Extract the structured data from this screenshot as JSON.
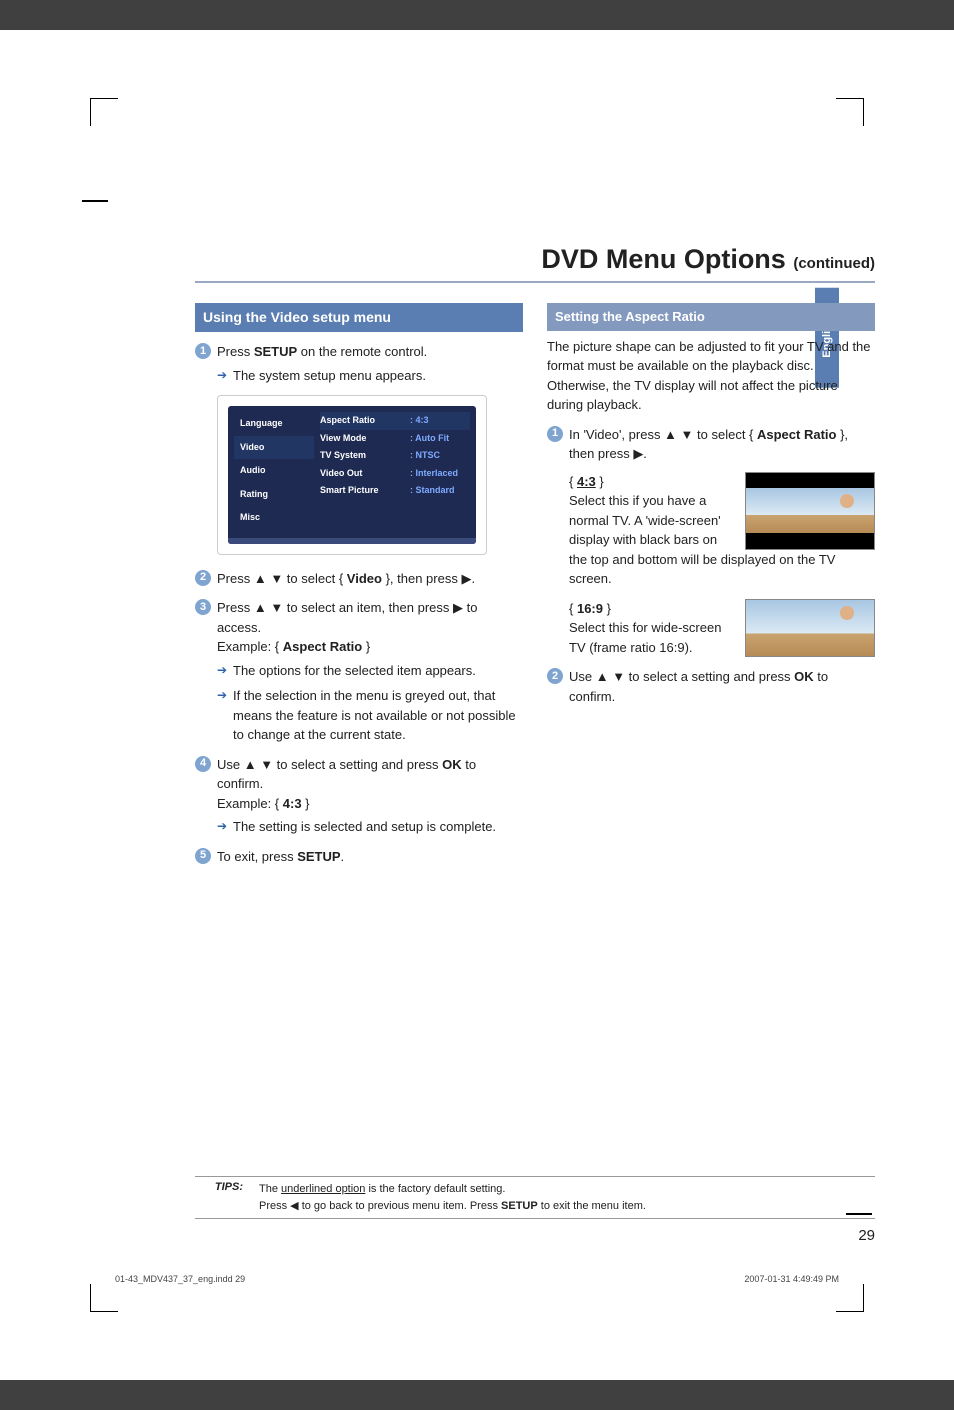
{
  "lang_tab": "English",
  "title": "DVD Menu Options",
  "title_sub": "(continued)",
  "left": {
    "heading": "Using the Video setup menu",
    "s1_a": "Press ",
    "s1_b": "SETUP",
    "s1_c": " on the remote control.",
    "s1_sub": "The system setup menu appears.",
    "s2_a": "Press ▲ ▼ to select { ",
    "s2_b": "Video",
    "s2_c": " }, then press ▶.",
    "s3": "Press ▲ ▼ to select an item, then press ▶ to access.",
    "s3_ex_a": "Example: { ",
    "s3_ex_b": "Aspect Ratio",
    "s3_ex_c": " }",
    "s3_sub1": "The options for the selected item appears.",
    "s3_sub2": "If the selection in the menu is greyed out, that means the feature is not available or not possible to change at the current state.",
    "s4_a": "Use ▲ ▼ to select a setting and press ",
    "s4_b": "OK",
    "s4_c": " to confirm.",
    "s4_ex_a": "Example: { ",
    "s4_ex_b": "4:3",
    "s4_ex_c": " }",
    "s4_sub": "The setting is selected and setup is complete.",
    "s5_a": "To exit, press ",
    "s5_b": "SETUP",
    "s5_c": "."
  },
  "osd": {
    "tabs": [
      "Language",
      "Video",
      "Audio",
      "Rating",
      "Misc"
    ],
    "rows": [
      {
        "label": "Aspect Ratio",
        "value": ": 4:3",
        "sel": true
      },
      {
        "label": "View Mode",
        "value": ": Auto Fit"
      },
      {
        "label": "TV System",
        "value": ": NTSC"
      },
      {
        "label": "Video Out",
        "value": ": Interlaced"
      },
      {
        "label": "Smart Picture",
        "value": ": Standard"
      }
    ]
  },
  "right": {
    "heading": "Setting the Aspect Ratio",
    "intro": "The picture shape can be adjusted to fit your TV and the format must be available on the playback disc. Otherwise, the TV display will not affect the picture during playback.",
    "s1_a": "In 'Video', press ▲ ▼ to select { ",
    "s1_b": "Aspect Ratio",
    "s1_c": " }, then press ▶.",
    "opt43_label": "4:3",
    "opt43_desc": "Select this if you have a normal TV. A  'wide-screen' display with black bars on the top and bottom will be displayed on the TV screen.",
    "opt169_label": "16:9",
    "opt169_desc": "Select this for wide-screen TV (frame ratio 16:9).",
    "s2_a": "Use ▲ ▼ to select a setting and press ",
    "s2_b": "OK",
    "s2_c": " to confirm."
  },
  "tips": {
    "label": "TIPS:",
    "line1_a": "The ",
    "line1_b": "underlined option",
    "line1_c": " is the factory default setting.",
    "line2_a": "Press  ◀ to go back to previous menu item. Press ",
    "line2_b": "SETUP",
    "line2_c": " to exit the menu item."
  },
  "page_num": "29",
  "footer_left": "01-43_MDV437_37_eng.indd   29",
  "footer_right": "2007-01-31   4:49:49 PM"
}
